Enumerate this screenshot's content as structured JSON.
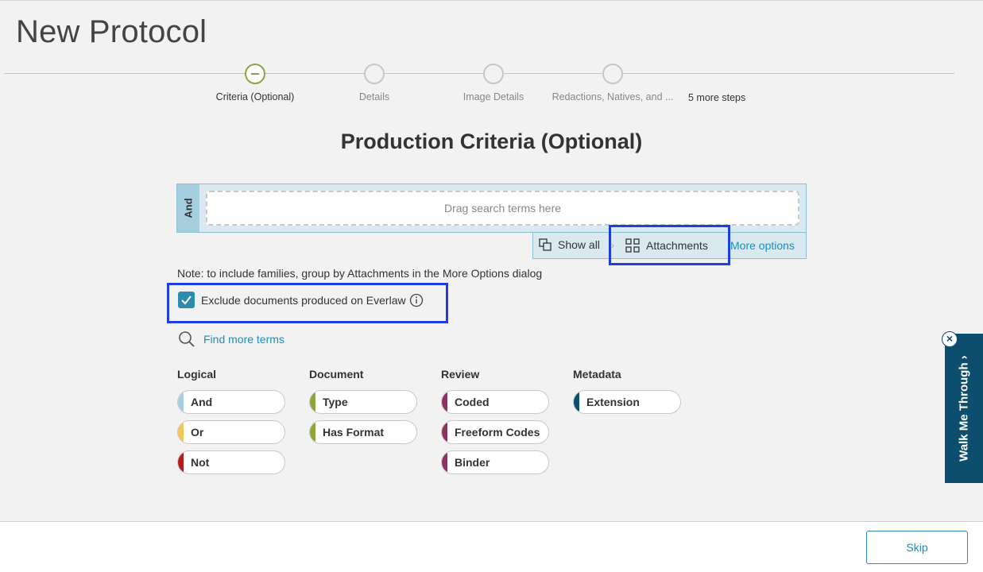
{
  "page": {
    "title": "New Protocol"
  },
  "stepper": {
    "steps": [
      {
        "label": "Criteria (Optional)",
        "active": true
      },
      {
        "label": "Details",
        "active": false
      },
      {
        "label": "Image Details",
        "active": false
      },
      {
        "label": "Redactions, Natives, and ...",
        "active": false
      }
    ],
    "more_steps": "5 more steps"
  },
  "section": {
    "title": "Production Criteria (Optional)"
  },
  "criteria": {
    "operator": "And",
    "drop_placeholder": "Drag search terms here",
    "show_all": "Show all",
    "attachments": "Attachments",
    "more_options": "More options"
  },
  "note": "Note: to include families, group by Attachments in the More Options dialog",
  "exclude": {
    "label": "Exclude documents produced on Everlaw",
    "checked": true
  },
  "find_more": "Find more terms",
  "categories": [
    {
      "title": "Logical",
      "items": [
        {
          "label": "And",
          "color": "#a5cfdf"
        },
        {
          "label": "Or",
          "color": "#f8c45a"
        },
        {
          "label": "Not",
          "color": "#b51c1c"
        }
      ]
    },
    {
      "title": "Document",
      "items": [
        {
          "label": "Type",
          "color": "#8ca63b"
        },
        {
          "label": "Has Format",
          "color": "#8ca63b"
        }
      ]
    },
    {
      "title": "Review",
      "items": [
        {
          "label": "Coded",
          "color": "#8a3461"
        },
        {
          "label": "Freeform Codes",
          "color": "#8a3461"
        },
        {
          "label": "Binder",
          "color": "#8a3461"
        }
      ]
    },
    {
      "title": "Metadata",
      "items": [
        {
          "label": "Extension",
          "color": "#0d4e6e"
        }
      ]
    }
  ],
  "walkthrough": {
    "label": "Walk Me Through",
    "close": "×"
  },
  "footer": {
    "skip": "Skip"
  },
  "colors": {
    "accent": "#1a8fbf",
    "highlight": "#1d3ee0",
    "walk_bg": "#0d4e6e"
  }
}
